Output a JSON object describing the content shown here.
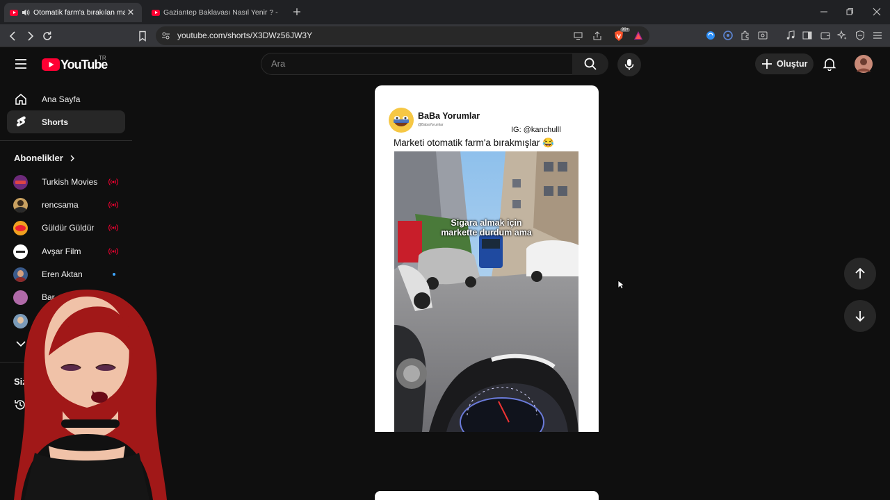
{
  "browser": {
    "tabs": [
      {
        "title": "Otomatik farm'a bırakılan ma",
        "active": true,
        "audio": true
      },
      {
        "title": "Gaziantep Baklavası Nasıl Yenir ? - Ke",
        "active": false,
        "audio": false
      }
    ],
    "url": "youtube.com/shorts/X3DWz56JW3Y",
    "shields_badge": "99+"
  },
  "youtube": {
    "logo_text": "YouTube",
    "region": "TR",
    "search_placeholder": "Ara",
    "create_label": "Oluştur"
  },
  "sidebar": {
    "nav": [
      {
        "label": "Ana Sayfa",
        "icon": "home-icon",
        "active": false
      },
      {
        "label": "Shorts",
        "icon": "shorts-icon",
        "active": true
      }
    ],
    "subscriptions_title": "Abonelikler",
    "subscriptions": [
      {
        "name": "Turkish Movies",
        "indicator": "live"
      },
      {
        "name": "rencsama",
        "indicator": "live"
      },
      {
        "name": "Güldür Güldür",
        "indicator": "live"
      },
      {
        "name": "Avşar Film",
        "indicator": "live"
      },
      {
        "name": "Eren Aktan",
        "indicator": "new"
      },
      {
        "name": "Bar",
        "indicator": "none"
      }
    ],
    "you_title": "Siz"
  },
  "short": {
    "channel_name": "BaBa Yorumlar",
    "channel_handle": "@BabaYorumlar",
    "ig_credit": "IG: @kanchulll",
    "caption": "Marketi otomatik farm'a bırakmışlar 😂",
    "overlay_line1": "Sigara almak için",
    "overlay_line2": "markette durdum ama"
  },
  "colors": {
    "accent": "#ff0033",
    "background": "#0f0f0f",
    "live": "#ff0033",
    "new_dot": "#3ea6ff"
  }
}
